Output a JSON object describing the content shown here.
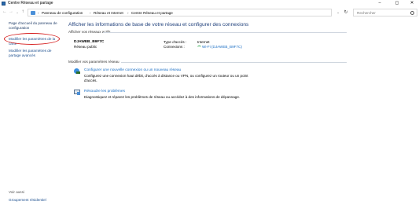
{
  "window": {
    "title": "Centre Réseau et partage",
    "minimize": "–",
    "maximize": "◻",
    "close": "✕"
  },
  "nav": {
    "back": "←",
    "forward": "→",
    "recent": "⌄",
    "up": "↑"
  },
  "address": {
    "crumbs": [
      "Panneau de configuration",
      "Réseau et Internet",
      "Centre Réseau et partage"
    ],
    "separator": "›",
    "dropdown": "⌄",
    "refresh": "↻"
  },
  "search": {
    "placeholder": "Rechercher"
  },
  "sidebar": {
    "home": "Page d'accueil du panneau de configuration",
    "adapter_settings": "Modifier les paramètres de la carte",
    "advanced_sharing": "Modifier les paramètres de partage avancés",
    "see_also": "Voir aussi",
    "homegroup": "Groupement résidentiel"
  },
  "main": {
    "heading": "Afficher les informations de base de votre réseau et configurer des connexions",
    "active_label": "Afficher vos réseaux actifs",
    "network": {
      "name": "DJAWEB_B9F7C",
      "type": "Réseau public",
      "access_label": "Type d'accès :",
      "access_value": "Internet",
      "connections_label": "Connexions :",
      "connections_value": "Wi-Fi (DJAWEB_B9F7C)"
    },
    "change_label": "Modifier vos paramètres réseau",
    "tasks": [
      {
        "link": "Configurer une nouvelle connexion ou un nouveau réseau",
        "description": "Configurez une connexion haut débit, d'accès à distance ou VPN, ou configurez un routeur ou un point d'accès."
      },
      {
        "link": "Résoudre les problèmes",
        "description": "Diagnostiquez et réparez les problèmes de réseau ou accédez à des informations de dépannage."
      }
    ]
  },
  "colors": {
    "link": "#1c6fc4",
    "heading": "#1e3f7a",
    "highlight": "#d62020",
    "wifi": "#2aa84a"
  },
  "icons": {
    "app": "network-sharing-icon",
    "search": "search-icon",
    "new_connection": "new-connection-icon",
    "troubleshoot": "troubleshoot-icon",
    "wifi": "wifi-icon"
  }
}
